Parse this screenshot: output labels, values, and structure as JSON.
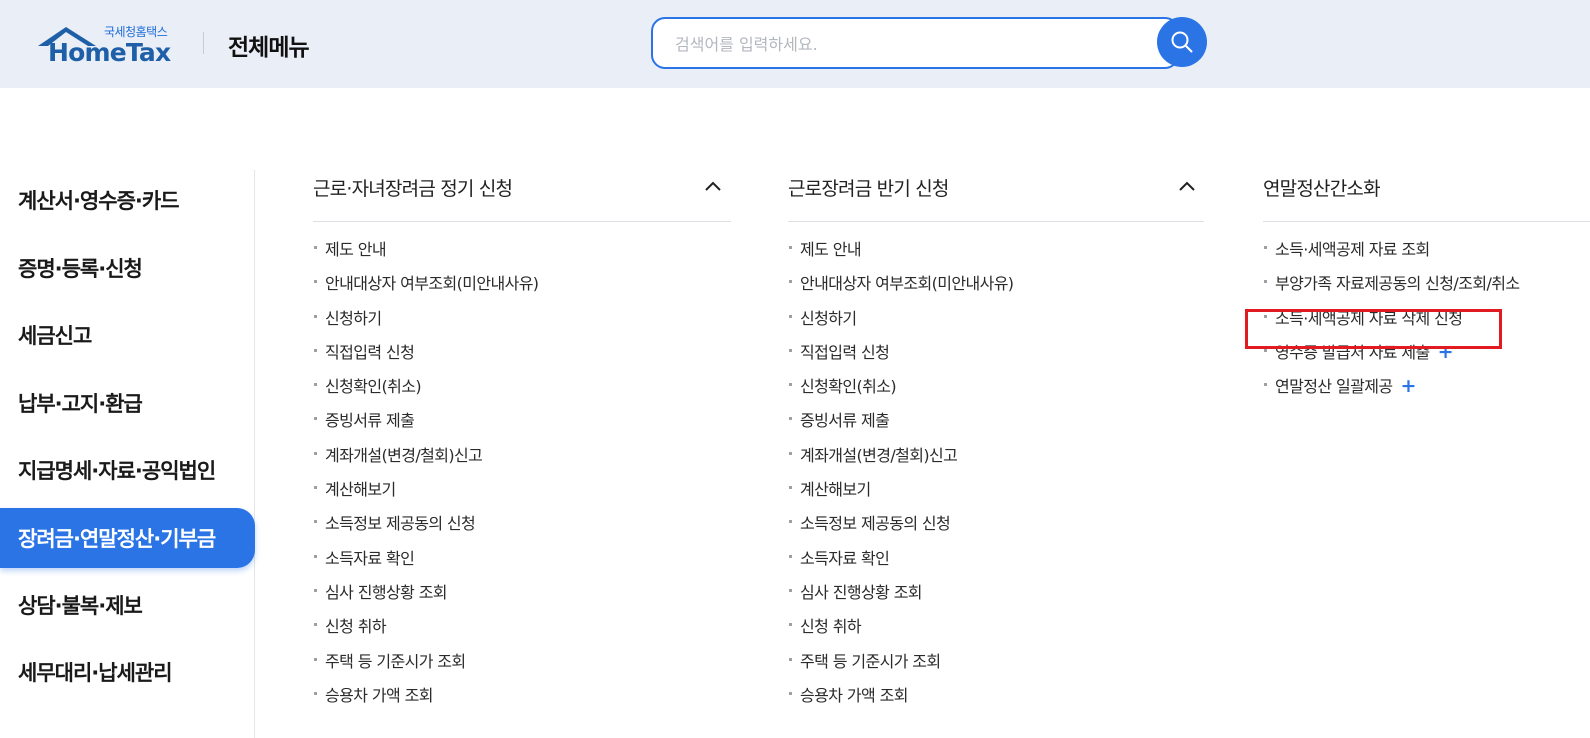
{
  "header": {
    "logo_small": "국세청홈택스",
    "logo_big": "HomeTax",
    "menu_title": "전체메뉴",
    "search_placeholder": "검색어를 입력하세요.",
    "accent_color": "#2a74e6"
  },
  "sidebar": {
    "items": [
      {
        "label": "계산서·영수증·카드",
        "active": false
      },
      {
        "label": "증명·등록·신청",
        "active": false
      },
      {
        "label": "세금신고",
        "active": false
      },
      {
        "label": "납부·고지·환급",
        "active": false
      },
      {
        "label": "지급명세·자료·공익법인",
        "active": false
      },
      {
        "label": "장려금·연말정산·기부금",
        "active": true
      },
      {
        "label": "상담·불복·제보",
        "active": false
      },
      {
        "label": "세무대리·납세관리",
        "active": false
      }
    ]
  },
  "columns": [
    {
      "title": "근로·자녀장려금 정기 신청",
      "collapsible": true,
      "items": [
        {
          "label": "제도 안내"
        },
        {
          "label": "안내대상자 여부조회(미안내사유)"
        },
        {
          "label": "신청하기"
        },
        {
          "label": "직접입력 신청"
        },
        {
          "label": "신청확인(취소)"
        },
        {
          "label": "증빙서류 제출"
        },
        {
          "label": "계좌개설(변경/철회)신고"
        },
        {
          "label": "계산해보기"
        },
        {
          "label": "소득정보 제공동의 신청"
        },
        {
          "label": "소득자료 확인"
        },
        {
          "label": "심사 진행상황 조회"
        },
        {
          "label": "신청 취하"
        },
        {
          "label": "주택 등 기준시가 조회"
        },
        {
          "label": "승용차 가액 조회"
        }
      ]
    },
    {
      "title": "근로장려금 반기 신청",
      "collapsible": true,
      "items": [
        {
          "label": "제도 안내"
        },
        {
          "label": "안내대상자 여부조회(미안내사유)"
        },
        {
          "label": "신청하기"
        },
        {
          "label": "직접입력 신청"
        },
        {
          "label": "신청확인(취소)"
        },
        {
          "label": "증빙서류 제출"
        },
        {
          "label": "계좌개설(변경/철회)신고"
        },
        {
          "label": "계산해보기"
        },
        {
          "label": "소득정보 제공동의 신청"
        },
        {
          "label": "소득자료 확인"
        },
        {
          "label": "심사 진행상황 조회"
        },
        {
          "label": "신청 취하"
        },
        {
          "label": "주택 등 기준시가 조회"
        },
        {
          "label": "승용차 가액 조회"
        }
      ]
    },
    {
      "title": "연말정산간소화",
      "collapsible": false,
      "items": [
        {
          "label": "소득·세액공제 자료 조회",
          "expandable": false
        },
        {
          "label": "부양가족 자료제공동의 신청/조회/취소",
          "expandable": false
        },
        {
          "label": "소득·세액공제 자료 삭제 신청",
          "expandable": false,
          "highlighted": true
        },
        {
          "label": "영수증 발급처 자료 제출",
          "expandable": true
        },
        {
          "label": "연말정산 일괄제공",
          "expandable": true
        }
      ]
    }
  ],
  "plus_symbol": "+",
  "highlight_color": "#e21b23"
}
